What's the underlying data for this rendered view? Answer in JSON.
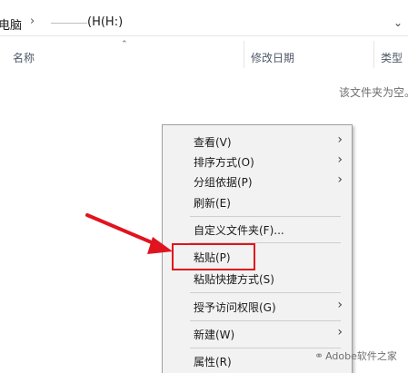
{
  "address_bar": {
    "root": "电脑",
    "separator": "›",
    "drive": "(H(H:)",
    "dropdown_icon": "chevron-down"
  },
  "columns": {
    "name": "名称",
    "date_modified": "修改日期",
    "type": "类型",
    "sort_icon": "sort-ascending"
  },
  "empty_message": "该文件夹为空。",
  "context_menu": {
    "items": [
      {
        "label": "查看(V)",
        "submenu": true
      },
      {
        "label": "排序方式(O)",
        "submenu": true
      },
      {
        "label": "分组依据(P)",
        "submenu": true
      },
      {
        "label": "刷新(E)",
        "submenu": false
      },
      {
        "label": "自定义文件夹(F)...",
        "submenu": false
      },
      {
        "label": "粘贴(P)",
        "submenu": false,
        "highlighted": true
      },
      {
        "label": "粘贴快捷方式(S)",
        "submenu": false
      },
      {
        "label": "授予访问权限(G)",
        "submenu": true
      },
      {
        "label": "新建(W)",
        "submenu": true
      },
      {
        "label": "属性(R)",
        "submenu": false
      }
    ],
    "arrow_glyph": "›"
  },
  "annotation": {
    "color": "#e0141e"
  },
  "watermark": {
    "text": "Adobe软件之家",
    "icon": "wechat-icon"
  }
}
